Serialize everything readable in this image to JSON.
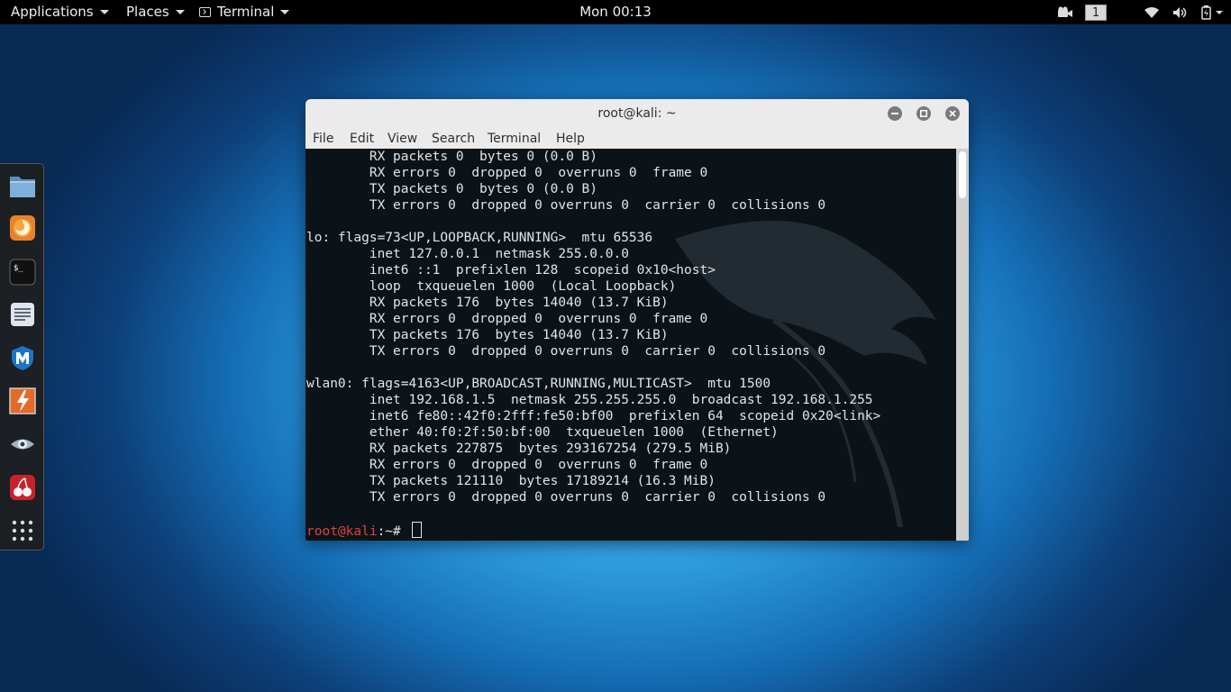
{
  "topbar": {
    "applications": "Applications",
    "places": "Places",
    "terminal": "Terminal",
    "clock": "Mon 00:13",
    "workspace": "1",
    "icons": [
      "video-camera-icon",
      "wifi-icon",
      "volume-icon",
      "battery-icon"
    ]
  },
  "dock": {
    "items": [
      "files-icon",
      "firefox-icon",
      "terminal-icon",
      "text-editor-icon",
      "metasploit-icon",
      "burp-suite-icon",
      "eye-icon",
      "cherry-icon",
      "show-apps-icon"
    ]
  },
  "window": {
    "title": "root@kali: ~",
    "menu": [
      "File",
      "Edit",
      "View",
      "Search",
      "Terminal",
      "Help"
    ],
    "lines": [
      "        RX packets 0  bytes 0 (0.0 B)",
      "        RX errors 0  dropped 0  overruns 0  frame 0",
      "        TX packets 0  bytes 0 (0.0 B)",
      "        TX errors 0  dropped 0 overruns 0  carrier 0  collisions 0",
      "",
      "lo: flags=73<UP,LOOPBACK,RUNNING>  mtu 65536",
      "        inet 127.0.0.1  netmask 255.0.0.0",
      "        inet6 ::1  prefixlen 128  scopeid 0x10<host>",
      "        loop  txqueuelen 1000  (Local Loopback)",
      "        RX packets 176  bytes 14040 (13.7 KiB)",
      "        RX errors 0  dropped 0  overruns 0  frame 0",
      "        TX packets 176  bytes 14040 (13.7 KiB)",
      "        TX errors 0  dropped 0 overruns 0  carrier 0  collisions 0",
      "",
      "wlan0: flags=4163<UP,BROADCAST,RUNNING,MULTICAST>  mtu 1500",
      "        inet 192.168.1.5  netmask 255.255.255.0  broadcast 192.168.1.255",
      "        inet6 fe80::42f0:2fff:fe50:bf00  prefixlen 64  scopeid 0x20<link>",
      "        ether 40:f0:2f:50:bf:00  txqueuelen 1000  (Ethernet)",
      "        RX packets 227875  bytes 293167254 (279.5 MiB)",
      "        RX errors 0  dropped 0  overruns 0  frame 0",
      "        TX packets 121110  bytes 17189214 (16.3 MiB)",
      "        TX errors 0  dropped 0 overruns 0  carrier 0  collisions 0"
    ],
    "prompt_user": "root@kali",
    "prompt_rest": ":~# ",
    "prompt_color": "#e0403a"
  }
}
